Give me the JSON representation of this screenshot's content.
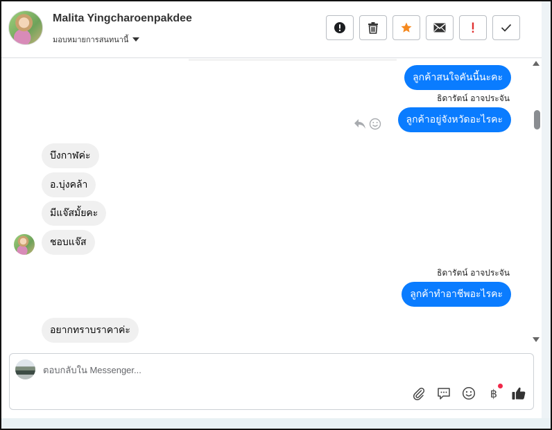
{
  "header": {
    "contact_name": "Malita Yingcharoenpakdee",
    "assign_label": "มอบหมายการสนทนานี้",
    "actions": [
      {
        "name": "mark-spam-button",
        "icon": "alert-circle-icon"
      },
      {
        "name": "delete-button",
        "icon": "trash-icon"
      },
      {
        "name": "star-button",
        "icon": "star-icon",
        "color": "#f5891f"
      },
      {
        "name": "mark-unread-button",
        "icon": "envelope-icon"
      },
      {
        "name": "important-button",
        "icon": "exclamation-icon",
        "color": "#e03030"
      },
      {
        "name": "mark-done-button",
        "icon": "check-icon"
      }
    ]
  },
  "thread": {
    "messages": [
      {
        "id": "m1",
        "direction": "out",
        "text": "ลูกค้าสนใจคันนี้นะคะ"
      },
      {
        "id": "m2",
        "direction": "out",
        "sender": "ธิดารัตน์ อาจประจัน",
        "text": "ลูกค้าอยู่จังหวัดอะไรคะ"
      },
      {
        "id": "m3",
        "direction": "in",
        "text": "บึงกาฬค่ะ"
      },
      {
        "id": "m4",
        "direction": "in",
        "text": "อ.บุ่งคล้า"
      },
      {
        "id": "m5",
        "direction": "in",
        "text": "มีแจ๊สมั้ยคะ"
      },
      {
        "id": "m6",
        "direction": "in",
        "text": "ชอบแจ๊ส"
      },
      {
        "id": "m7",
        "direction": "out",
        "sender": "ธิดารัตน์ อาจประจัน",
        "text": "ลูกค้าทำอาชีพอะไรคะ"
      },
      {
        "id": "m8",
        "direction": "in",
        "text": "อยากทราบราคาค่ะ"
      }
    ]
  },
  "composer": {
    "placeholder": "ตอบกลับใน Messenger...",
    "value": "",
    "tools": [
      "paperclip-icon",
      "chat-bubble-icon",
      "emoji-icon",
      "baht-icon",
      "thumbs-up-icon"
    ],
    "baht_symbol": "฿"
  },
  "colors": {
    "outgoing_bubble": "#0a7cff",
    "incoming_bubble": "#f0f0f0",
    "notification_dot": "#f02849"
  }
}
